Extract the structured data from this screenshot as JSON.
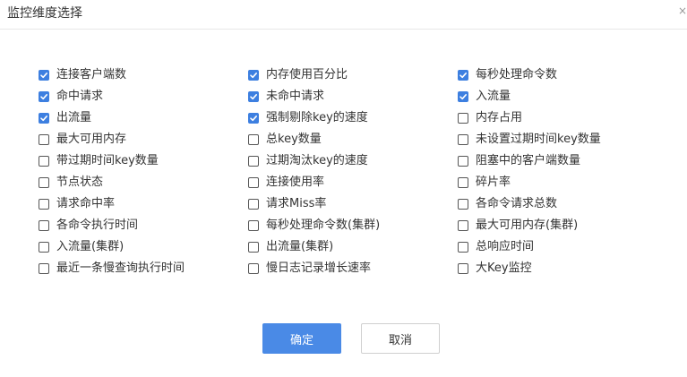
{
  "dialog": {
    "title": "监控维度选择",
    "close_symbol": "×"
  },
  "colors": {
    "accent": "#4a8ae6",
    "checkbox_checked": "#3d7fe0"
  },
  "options": [
    {
      "label": "连接客户端数",
      "checked": true
    },
    {
      "label": "内存使用百分比",
      "checked": true
    },
    {
      "label": "每秒处理命令数",
      "checked": true
    },
    {
      "label": "命中请求",
      "checked": true
    },
    {
      "label": "未命中请求",
      "checked": true
    },
    {
      "label": "入流量",
      "checked": true
    },
    {
      "label": "出流量",
      "checked": true
    },
    {
      "label": "强制剔除key的速度",
      "checked": true
    },
    {
      "label": "内存占用",
      "checked": false
    },
    {
      "label": "最大可用内存",
      "checked": false
    },
    {
      "label": "总key数量",
      "checked": false
    },
    {
      "label": "未设置过期时间key数量",
      "checked": false
    },
    {
      "label": "带过期时间key数量",
      "checked": false
    },
    {
      "label": "过期淘汰key的速度",
      "checked": false
    },
    {
      "label": "阻塞中的客户端数量",
      "checked": false
    },
    {
      "label": "节点状态",
      "checked": false
    },
    {
      "label": "连接使用率",
      "checked": false
    },
    {
      "label": "碎片率",
      "checked": false
    },
    {
      "label": "请求命中率",
      "checked": false
    },
    {
      "label": "请求Miss率",
      "checked": false
    },
    {
      "label": "各命令请求总数",
      "checked": false
    },
    {
      "label": "各命令执行时间",
      "checked": false
    },
    {
      "label": "每秒处理命令数(集群)",
      "checked": false
    },
    {
      "label": "最大可用内存(集群)",
      "checked": false
    },
    {
      "label": "入流量(集群)",
      "checked": false
    },
    {
      "label": "出流量(集群)",
      "checked": false
    },
    {
      "label": "总响应时间",
      "checked": false
    },
    {
      "label": "最近一条慢查询执行时间",
      "checked": false
    },
    {
      "label": "慢日志记录增长速率",
      "checked": false
    },
    {
      "label": "大Key监控",
      "checked": false
    }
  ],
  "buttons": {
    "ok_label": "确定",
    "cancel_label": "取消"
  }
}
